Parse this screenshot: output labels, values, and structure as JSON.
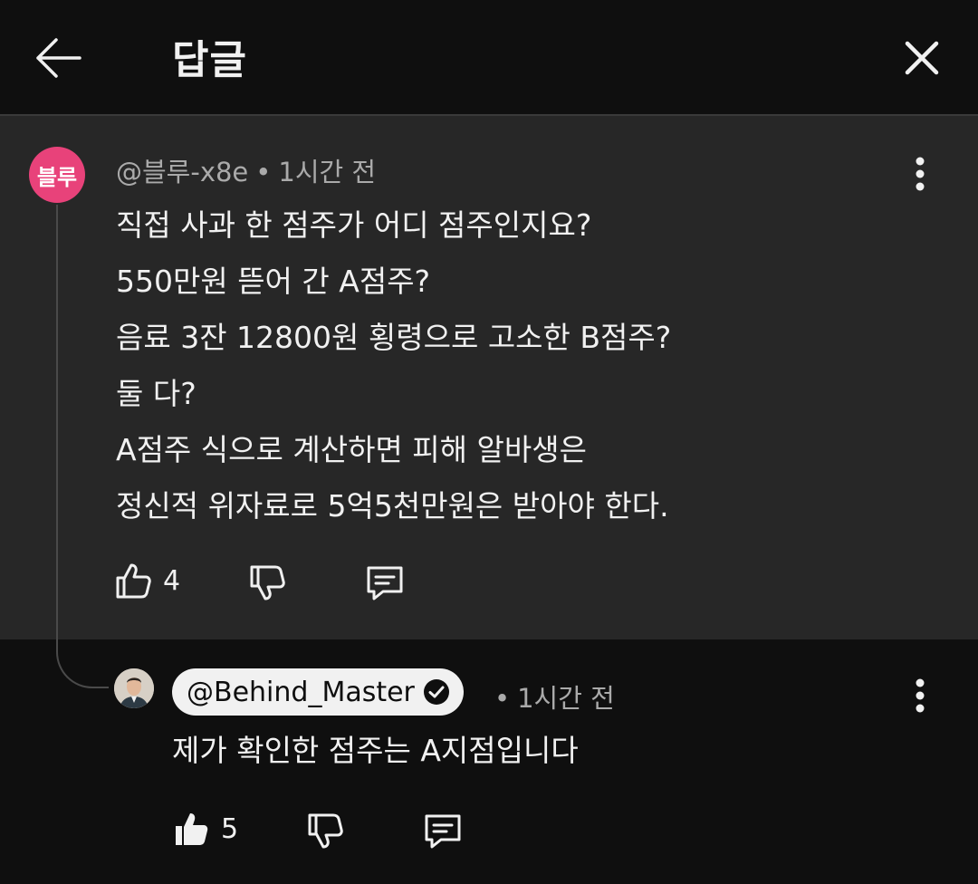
{
  "header": {
    "title": "답글"
  },
  "comment": {
    "avatar_text": "블루",
    "avatar_color": "#e8427a",
    "author": "@블루-x8e",
    "separator": "•",
    "time": "1시간 전",
    "lines": [
      "직접 사과 한 점주가 어디 점주인지요?",
      "550만원 뜯어 간 A점주?",
      "음료 3잔 12800원 횡령으로 고소한 B점주?",
      "둘 다?",
      "A점주 식으로 계산하면 피해 알바생은",
      "정신적 위자료로 5억5천만원은 받아야 한다."
    ],
    "likes": "4"
  },
  "reply": {
    "author": "@Behind_Master",
    "verified": "checkmark-badge-icon",
    "separator": "•",
    "time": "1시간 전",
    "text": "제가 확인한 점주는 A지점입니다",
    "likes": "5"
  },
  "colors": {
    "background": "#0f0f0f",
    "parent_background": "#272727",
    "text": "#f1f1f1",
    "secondary_text": "#aaaaaa"
  }
}
